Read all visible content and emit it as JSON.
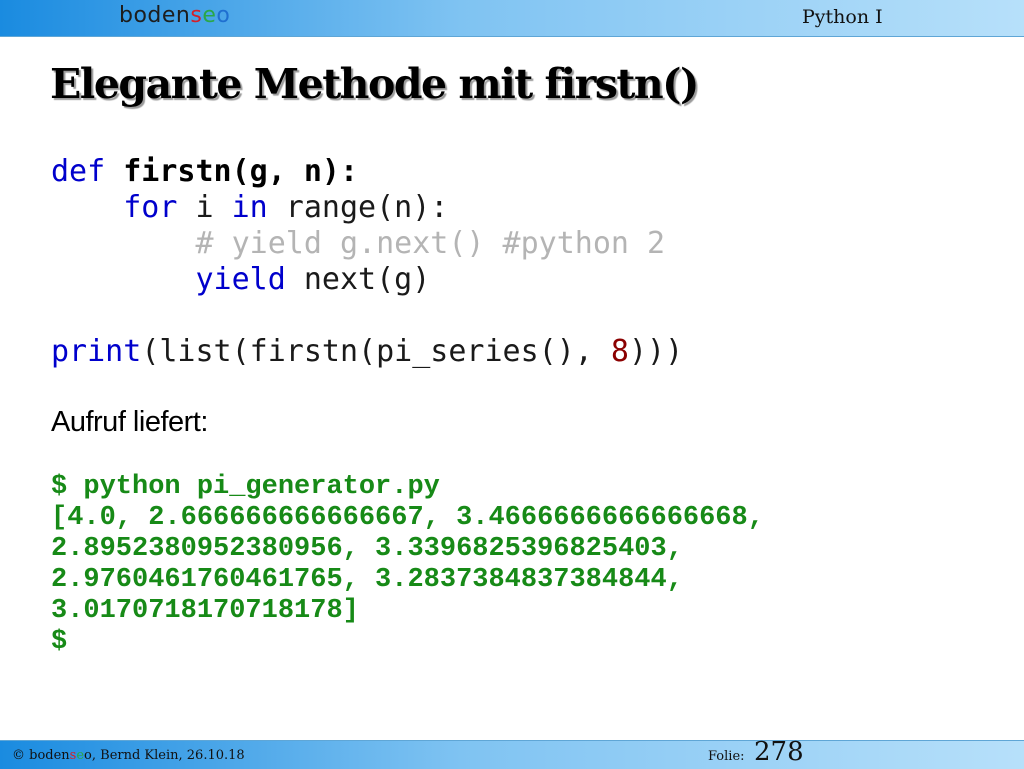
{
  "header": {
    "logo_parts": [
      "boden",
      "s",
      "e",
      "o"
    ],
    "course": "Python I"
  },
  "slide": {
    "title": "Elegante Methode mit firstn()",
    "code": {
      "def_kw": "def",
      "signature": "firstn(g, n):",
      "for_kw": "for",
      "for_var": " i ",
      "in_kw": "in",
      "for_rest": " range(n):",
      "comment": "# yield g.next() #python 2",
      "yield_kw": "yield",
      "yield_rest": " next(g)",
      "print_fn": "print",
      "print_args": "(list(firstn(pi_series(), ",
      "print_num": "8",
      "print_close": ")))"
    },
    "result_label": "Aufruf liefert:",
    "output_lines": [
      "$ python pi_generator.py",
      "[4.0, 2.666666666666667, 3.4666666666666668,",
      "2.8952380952380956, 3.3396825396825403,",
      "2.9760461760461765, 3.2837384837384844,",
      "3.0170718170718178]",
      "$"
    ]
  },
  "footer": {
    "copyright_prefix": "© boden",
    "copyright_s": "s",
    "copyright_e": "e",
    "copyright_o": "o",
    "copyright_rest": ", Bernd Klein, 26.10.18",
    "folie_label": "Folie:",
    "page_number": "278"
  },
  "colors": {
    "header_gradient_start": "#1a8be0",
    "keyword_blue": "#0000cc",
    "comment_gray": "#b4b4b4",
    "number_darkred": "#8b0000",
    "output_green": "#178a17"
  }
}
